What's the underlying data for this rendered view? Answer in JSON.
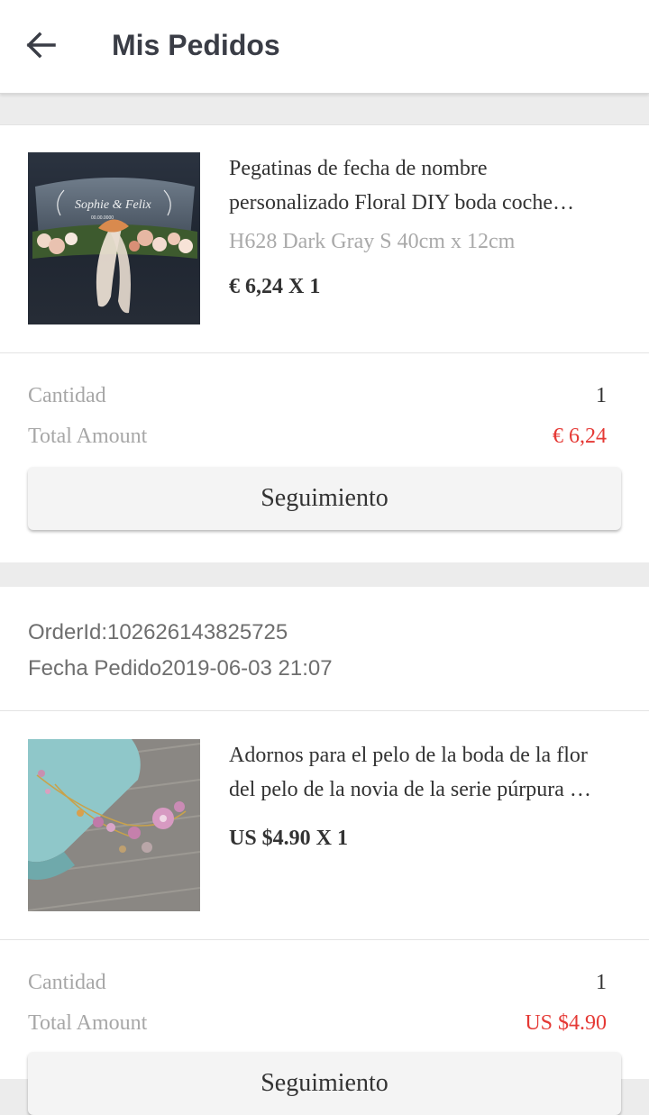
{
  "header": {
    "title": "Mis Pedidos",
    "back_icon": "arrow-left-icon"
  },
  "orders": [
    {
      "product": {
        "title_lines": [
          "Pegatinas de fecha de nombre",
          "personalizado Floral DIY boda coche…"
        ],
        "variant": "H628 Dark Gray S 40cm x 12cm",
        "price": "€ 6,24 X 1"
      },
      "summary": {
        "qty_label": "Cantidad",
        "qty_value": "1",
        "total_label": "Total Amount",
        "total_value": "€ 6,24"
      },
      "button_label": "Seguimiento"
    },
    {
      "order_id": "OrderId:102626143825725",
      "order_date": "Fecha Pedido2019-06-03 21:07",
      "product": {
        "title_lines": [
          "Adornos para el pelo de la boda de la flor",
          "del pelo de la novia de la serie púrpura …"
        ],
        "price": "US $4.90 X 1"
      },
      "summary": {
        "qty_label": "Cantidad",
        "qty_value": "1",
        "total_label": "Total Amount",
        "total_value": "US $4.90"
      },
      "button_label": "Seguimiento"
    }
  ],
  "colors": {
    "accent_red": "#e53935",
    "text_dark": "#333333",
    "text_muted": "#a7a7a7"
  }
}
